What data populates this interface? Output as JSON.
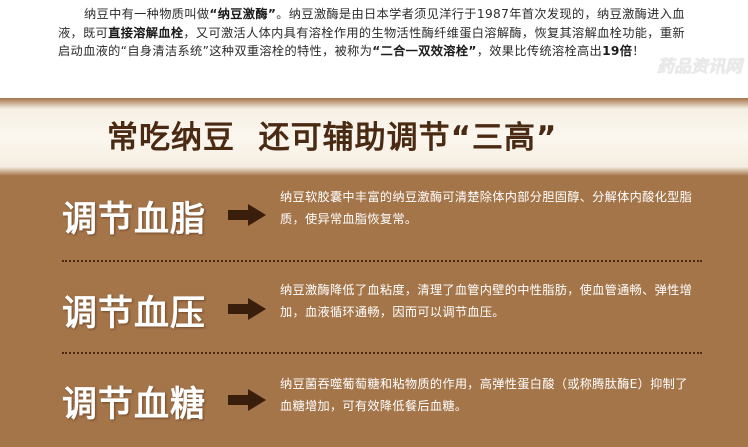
{
  "intro": {
    "p1": "纳豆中有一种物质叫做",
    "b1": "“纳豆激酶”",
    "p2": "。纳豆激酶是由日本学者须见洋行于1987年首次发现的，纳豆激酶进入血液，既可",
    "b2": "直接溶解血栓",
    "p3": "，又可激活人体内具有溶栓作用的生物活性酶纤维蛋白溶解酶，恢复其溶解血栓功能，重新启动血液的“自身清洁系统”这种双重溶栓的特性，被称为",
    "b3": "“二合一双效溶栓”",
    "p4": "，效果比传统溶栓高出",
    "b4": "19倍",
    "p5": "！"
  },
  "watermark": "药品资讯网",
  "panel": {
    "title": "常吃纳豆  还可辅助调节“三高”",
    "rows": [
      {
        "label": "调节血脂",
        "text": "纳豆软胶囊中丰富的纳豆激酶可清楚除体内部分胆固醇、分解体内酸化型脂质，使异常血脂恢复常。"
      },
      {
        "label": "调节血压",
        "text": "纳豆激酶降低了血粘度，清理了血管内壁的中性脂肪，使血管通畅、弹性增加，血液循环通畅，因而可以调节血压。"
      },
      {
        "label": "调节血糖",
        "text": "纳豆菌吞噬葡萄糖和粘物质的作用，高弹性蛋白酸（或称腾肽酶E）抑制了血糖增加，可有效降低餐后血糖。"
      }
    ]
  },
  "colors": {
    "panel_bg": "#a5754a",
    "title_color": "#4a2a12",
    "arrow_color": "#3a1e0c"
  }
}
